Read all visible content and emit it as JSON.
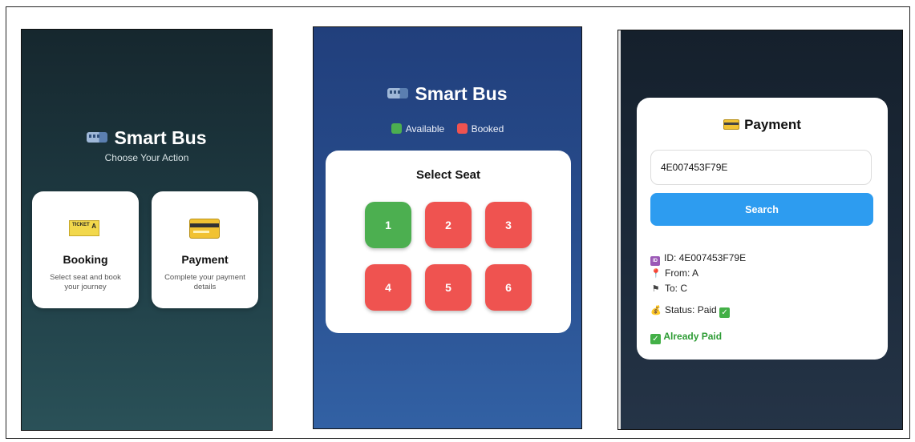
{
  "app_name": "Smart Bus",
  "home": {
    "subtitle": "Choose Your Action",
    "cards": [
      {
        "title": "Booking",
        "description": "Select seat and book your journey",
        "icon": "ticket-icon"
      },
      {
        "title": "Payment",
        "description": "Complete your payment details",
        "icon": "credit-card-icon"
      }
    ],
    "ticket_icon_text": "TICKET",
    "ticket_icon_letter": "A"
  },
  "seat_select": {
    "legend": [
      {
        "label": "Available",
        "color": "#4caf50"
      },
      {
        "label": "Booked",
        "color": "#ef5350"
      }
    ],
    "panel_title": "Select Seat",
    "seats": [
      {
        "number": "1",
        "status": "available",
        "color": "#4caf50"
      },
      {
        "number": "2",
        "status": "booked",
        "color": "#ef5350"
      },
      {
        "number": "3",
        "status": "booked",
        "color": "#ef5350"
      },
      {
        "number": "4",
        "status": "booked",
        "color": "#ef5350"
      },
      {
        "number": "5",
        "status": "booked",
        "color": "#ef5350"
      },
      {
        "number": "6",
        "status": "booked",
        "color": "#ef5350"
      }
    ]
  },
  "payment": {
    "title": "Payment",
    "input_value": "4E007453F79E",
    "search_label": "Search",
    "id_line": "ID: 4E007453F79E",
    "from_line": "From: A",
    "to_line": "To: C",
    "status_line": "Status: Paid",
    "message": "Already Paid"
  },
  "colors": {
    "accent_blue": "#2d9cf0",
    "available": "#4caf50",
    "booked": "#ef5350",
    "success_text": "#2e9c35"
  }
}
